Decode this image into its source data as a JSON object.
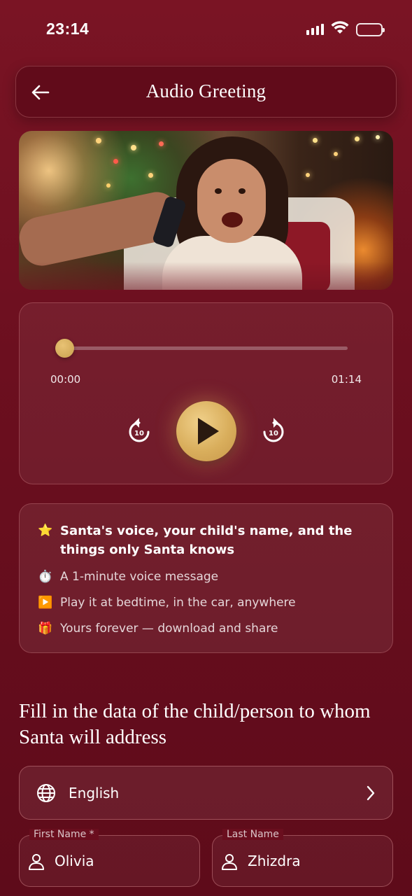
{
  "status_bar": {
    "time": "23:14",
    "icons": [
      "signal-icon",
      "wifi-icon",
      "battery-icon"
    ],
    "battery_color": "#f5c518"
  },
  "header": {
    "title": "Audio Greeting",
    "back_icon": "arrow-left-icon"
  },
  "player": {
    "current_time": "00:00",
    "total_time": "01:14",
    "progress": 0,
    "skip_back_label": "10",
    "skip_forward_label": "10",
    "accent_color": "#d9ae5c"
  },
  "features": {
    "items": [
      {
        "icon": "⭐",
        "text": "Santa's voice, your child's name, and the things only Santa knows"
      },
      {
        "icon": "⏱️",
        "text": "A 1-minute voice message"
      },
      {
        "icon": "▶️",
        "text": "Play it at bedtime, in the car, anywhere"
      },
      {
        "icon": "🎁",
        "text": "Yours forever — download and share"
      }
    ]
  },
  "form": {
    "title": "Fill in the data of the child/person to whom Santa will address",
    "language": "English",
    "first_name_label": "First Name *",
    "first_name_value": "Olivia",
    "last_name_label": "Last Name",
    "last_name_value": "Zhizdra"
  }
}
